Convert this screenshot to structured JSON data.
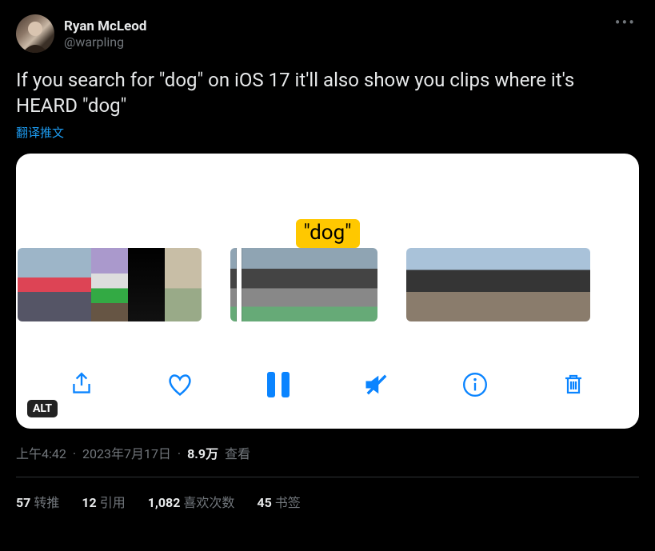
{
  "author": {
    "display_name": "Ryan McLeod",
    "handle": "@warpling"
  },
  "body_text": "If you search for \"dog\" on iOS 17 it'll also show you clips where it's HEARD \"dog\"",
  "translate_label": "翻译推文",
  "media": {
    "highlight_tag": "\"dog\"",
    "alt_badge": "ALT",
    "toolbar": {
      "share": "share",
      "like": "like",
      "pause": "pause",
      "mute": "mute",
      "info": "info",
      "trash": "trash"
    }
  },
  "meta": {
    "time": "上午4:42",
    "date": "2023年7月17日",
    "views_count": "8.9万",
    "views_label": "查看"
  },
  "stats": {
    "retweets_count": "57",
    "retweets_label": "转推",
    "quotes_count": "12",
    "quotes_label": "引用",
    "likes_count": "1,082",
    "likes_label": "喜欢次数",
    "bookmarks_count": "45",
    "bookmarks_label": "书签"
  }
}
